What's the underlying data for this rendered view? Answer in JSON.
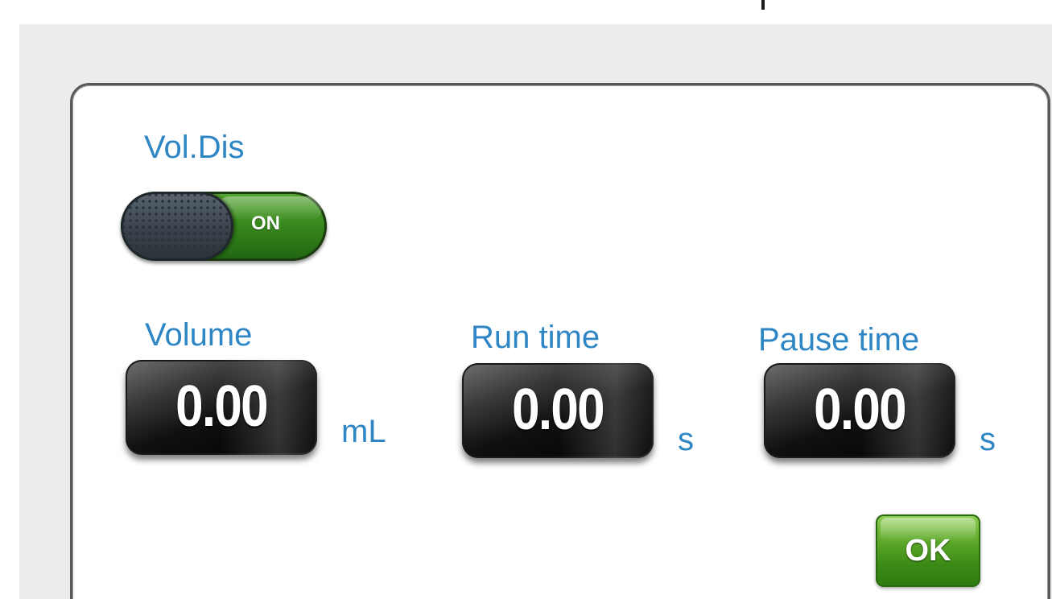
{
  "dialog": {
    "section_title": "Vol.Dis",
    "toggle": {
      "label": "ON",
      "state": "on"
    },
    "fields": {
      "volume": {
        "label": "Volume",
        "value": "0.00",
        "unit": "mL"
      },
      "run_time": {
        "label": "Run time",
        "value": "0.00",
        "unit": "s"
      },
      "pause_time": {
        "label": "Pause time",
        "value": "0.00",
        "unit": "s"
      }
    },
    "ok_label": "OK"
  },
  "colors": {
    "label_blue": "#2f86c5",
    "toggle_green": "#3a8a1e",
    "ok_green": "#5aa628",
    "display_black": "#000000"
  }
}
